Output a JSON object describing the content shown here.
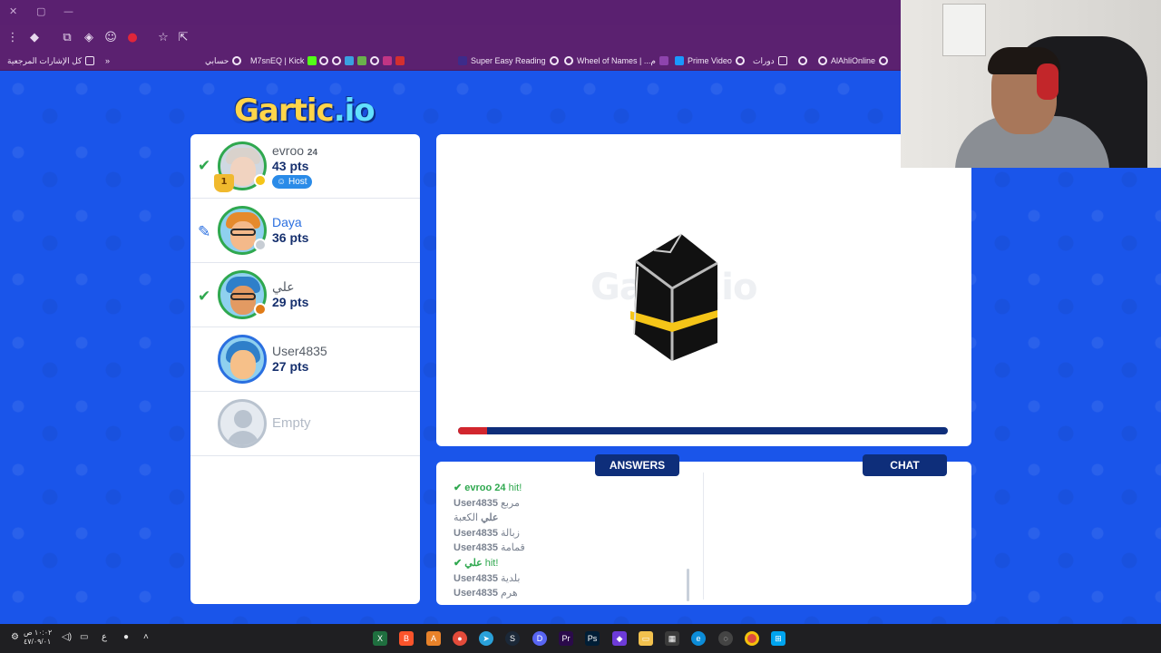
{
  "browser": {
    "bookmarks": [
      {
        "label": "كل الإشارات المرجعية",
        "icon": "folder-icon"
      },
      {
        "label": "حسابي",
        "icon": "globe-icon"
      },
      {
        "label": "M7snEQ | Kick",
        "icon": "globe-icon"
      },
      {
        "label": "Super Easy Reading",
        "icon": "globe-icon"
      },
      {
        "label": "Wheel of Names | ...م",
        "icon": "globe-icon"
      },
      {
        "label": "Prime Video",
        "icon": "globe-icon"
      },
      {
        "label": "دورات",
        "icon": "folder-icon"
      },
      {
        "label": "AlAhliOnline",
        "icon": "globe-icon"
      }
    ],
    "more_bookmarks": "»"
  },
  "game": {
    "logo_main": "Gartic",
    "logo_suffix": ".io",
    "canvas_watermark": "Gartic.io",
    "round_progress": 0.06,
    "players": [
      {
        "name": "evroo",
        "tag": "24",
        "points": "43 pts",
        "status": "guessed",
        "host_label": "Host",
        "badge": "1",
        "dot_color": "#f5c518"
      },
      {
        "name": "Daya",
        "tag": "",
        "points": "36 pts",
        "status": "drawing",
        "dot_color": "#c7cdd4"
      },
      {
        "name": "علي",
        "tag": "",
        "points": "29 pts",
        "status": "guessed",
        "dot_color": "#e07b17"
      },
      {
        "name": "User4835",
        "tag": "",
        "points": "27 pts",
        "status": "none"
      },
      {
        "name": "Empty",
        "status": "empty"
      }
    ],
    "answers_tab": "ANSWERS",
    "chat_tab": "CHAT",
    "answers": [
      {
        "user": "evroo 24",
        "text": "hit!",
        "hit": true
      },
      {
        "user": "User4835",
        "text": "مربع",
        "hit": false
      },
      {
        "user": "علي",
        "text": "الكعبة",
        "hit": false
      },
      {
        "user": "User4835",
        "text": "زبالة",
        "hit": false
      },
      {
        "user": "User4835",
        "text": "قمامة",
        "hit": false
      },
      {
        "user": "علي",
        "text": "hit!",
        "hit": true
      },
      {
        "user": "User4835",
        "text": "بلدية",
        "hit": false
      },
      {
        "user": "User4835",
        "text": "هرم",
        "hit": false
      }
    ]
  },
  "taskbar": {
    "clock_time": "١٠:٠٢ ص",
    "clock_date": "٤٧/٠٩/٠١",
    "lang": "ع"
  }
}
